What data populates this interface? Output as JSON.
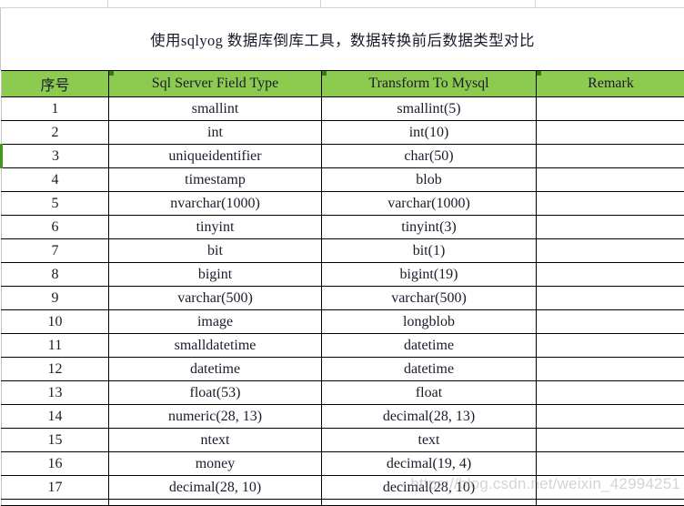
{
  "document": {
    "title": "使用sqlyog 数据库倒库工具，数据转换前后数据类型对比",
    "watermark": "https://blog.csdn.net/weixin_42994251",
    "accent_color": "#8DCB50",
    "header_text_color": "#1b1b2b",
    "grid_line_color": "#000000",
    "selected_row_marker_color": "#3f9a1e"
  },
  "table": {
    "columns": [
      {
        "key": "seq",
        "label": "序号"
      },
      {
        "key": "source",
        "label": "Sql Server Field Type"
      },
      {
        "key": "target",
        "label": "Transform To Mysql"
      },
      {
        "key": "remark",
        "label": "Remark"
      }
    ],
    "rows": [
      {
        "seq": "1",
        "source": "smallint",
        "target": "smallint(5)",
        "remark": "",
        "selected": false
      },
      {
        "seq": "2",
        "source": "int",
        "target": "int(10)",
        "remark": "",
        "selected": false
      },
      {
        "seq": "3",
        "source": "uniqueidentifier",
        "target": "char(50)",
        "remark": "",
        "selected": true
      },
      {
        "seq": "4",
        "source": "timestamp",
        "target": "blob",
        "remark": "",
        "selected": false
      },
      {
        "seq": "5",
        "source": "nvarchar(1000)",
        "target": "varchar(1000)",
        "remark": "",
        "selected": false
      },
      {
        "seq": "6",
        "source": "tinyint",
        "target": "tinyint(3)",
        "remark": "",
        "selected": false
      },
      {
        "seq": "7",
        "source": "bit",
        "target": "bit(1)",
        "remark": "",
        "selected": false
      },
      {
        "seq": "8",
        "source": "bigint",
        "target": "bigint(19)",
        "remark": "",
        "selected": false
      },
      {
        "seq": "9",
        "source": "varchar(500)",
        "target": "varchar(500)",
        "remark": "",
        "selected": false
      },
      {
        "seq": "10",
        "source": "image",
        "target": "longblob",
        "remark": "",
        "selected": false
      },
      {
        "seq": "11",
        "source": "smalldatetime",
        "target": "datetime",
        "remark": "",
        "selected": false
      },
      {
        "seq": "12",
        "source": "datetime",
        "target": "datetime",
        "remark": "",
        "selected": false
      },
      {
        "seq": "13",
        "source": "float(53)",
        "target": "float",
        "remark": "",
        "selected": false
      },
      {
        "seq": "14",
        "source": "numeric(28, 13)",
        "target": "decimal(28, 13)",
        "remark": "",
        "selected": false
      },
      {
        "seq": "15",
        "source": "ntext",
        "target": "text",
        "remark": "",
        "selected": false
      },
      {
        "seq": "16",
        "source": "money",
        "target": "decimal(19, 4)",
        "remark": "",
        "selected": false
      },
      {
        "seq": "17",
        "source": "decimal(28, 10)",
        "target": "decimal(28, 10)",
        "remark": "",
        "selected": false
      }
    ]
  }
}
